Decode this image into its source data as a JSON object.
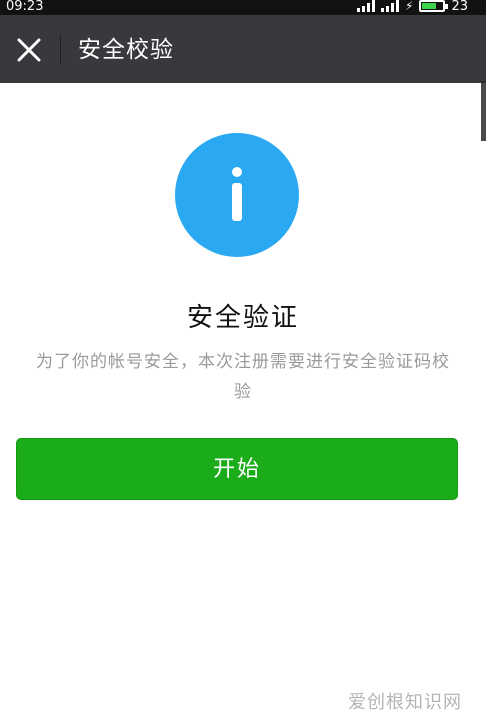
{
  "status_bar": {
    "time": "09:23",
    "battery_level_text": "23",
    "battery_fill_fraction": 0.6
  },
  "header": {
    "title": "安全校验",
    "close_icon": "close-icon",
    "background": "#38383d"
  },
  "content": {
    "icon": "info-icon",
    "icon_color": "#2aa9f2",
    "heading": "安全验证",
    "description": "为了你的帐号安全，本次注册需要进行安全验证码校验"
  },
  "actions": {
    "start_label": "开始",
    "start_color": "#1aad19"
  },
  "watermark": {
    "text": "爱创根知识网"
  }
}
